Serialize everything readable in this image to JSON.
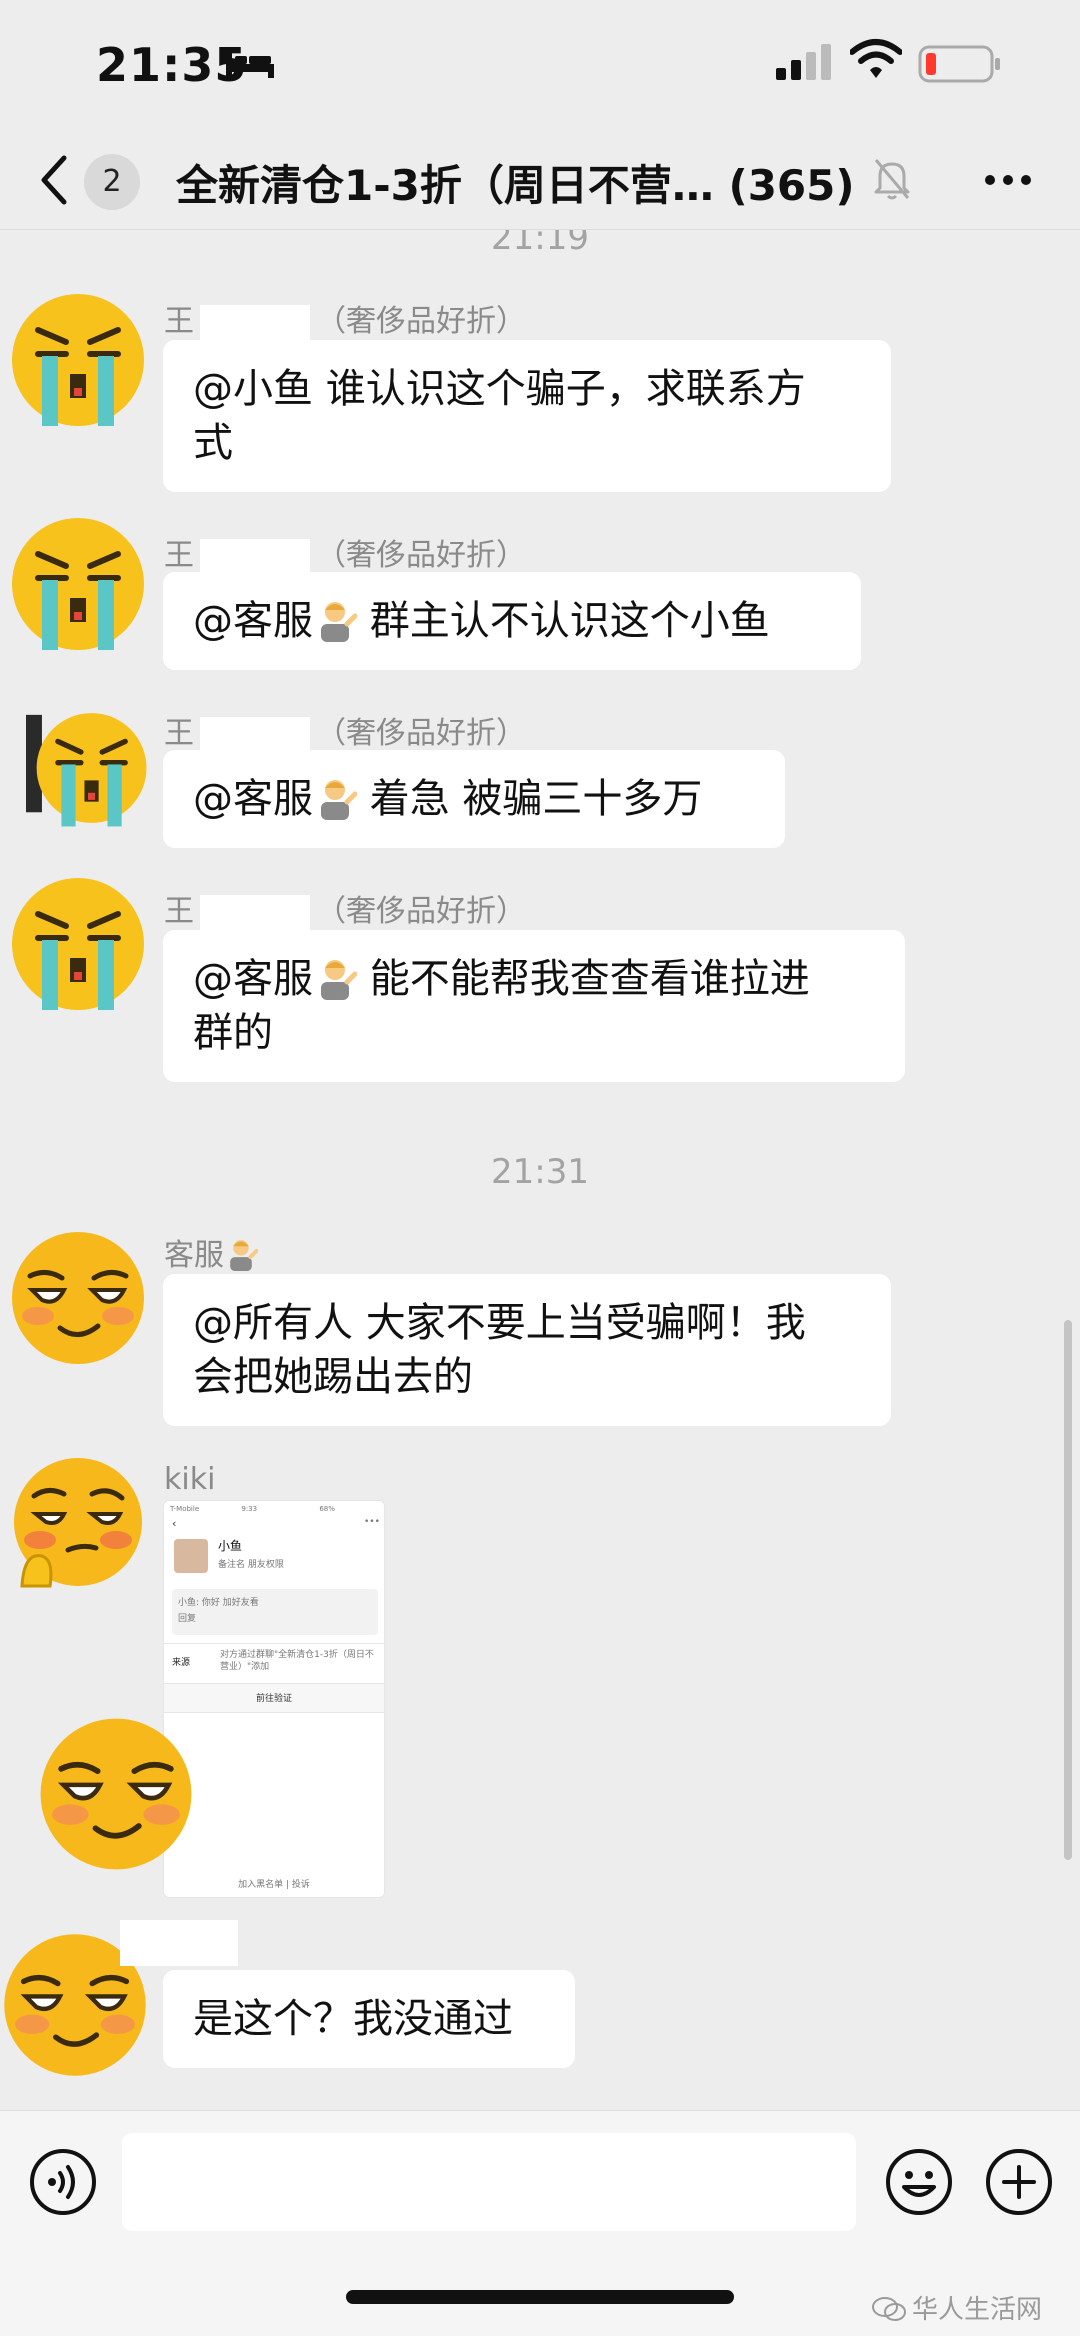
{
  "status_bar": {
    "time": "21:35"
  },
  "header": {
    "back_label": "返回",
    "unread_count": "2",
    "title": "全新清仓1-3折（周日不营…",
    "member_count": "(365)"
  },
  "timestamps": [
    "21:19",
    "21:31"
  ],
  "messages": [
    {
      "sender_prefix": "王",
      "sender_suffix": "（奢侈品好折）",
      "text_a": "@小鱼 谁认识这个骗子，求联系方",
      "text_b": "式"
    },
    {
      "sender_prefix": "王",
      "sender_suffix": "（奢侈品好折）",
      "mention": "@客服",
      "text_a": " 群主认不认识这个小鱼"
    },
    {
      "sender_prefix": "王",
      "sender_suffix": "（奢侈品好折）",
      "mention": "@客服",
      "text_a": " 着急 被骗三十多万"
    },
    {
      "sender_prefix": "王",
      "sender_suffix": "（奢侈品好折）",
      "mention": "@客服",
      "text_a": " 能不能帮我查查看谁拉进",
      "text_b": "群的"
    },
    {
      "sender": "客服",
      "text_a": "@所有人 大家不要上当受骗啊！我",
      "text_b": "会把她踢出去的"
    },
    {
      "sender": "kiki"
    },
    {
      "sender": "",
      "text_a": "是这个？我没通过"
    }
  ],
  "image_message": {
    "carrier": "T-Mobile",
    "time": "9:33",
    "battery": "68%",
    "contact_name": "小鱼",
    "row_labels": "备注名  朋友权限",
    "note_line1": "小鱼: 你好 加好友看",
    "note_line2": "回复",
    "source_label": "来源",
    "source_text": "对方通过群聊\"全新清仓1-3折（周日不营业）\"添加",
    "verify_button": "前往验证",
    "footer": "加入黑名单  |  投诉"
  },
  "watermark": "华人生活网",
  "colors": {
    "background": "#ededed",
    "bubble": "#ffffff",
    "timestamp": "#a3a3a3",
    "emoji_yellow": "#f7c21b",
    "tears": "#5bc6c6"
  },
  "icons": [
    "bed-icon",
    "signal-icon",
    "wifi-icon",
    "battery-icon",
    "back-icon",
    "mute-icon",
    "more-icon",
    "voice-icon",
    "emoji-icon",
    "plus-icon"
  ]
}
